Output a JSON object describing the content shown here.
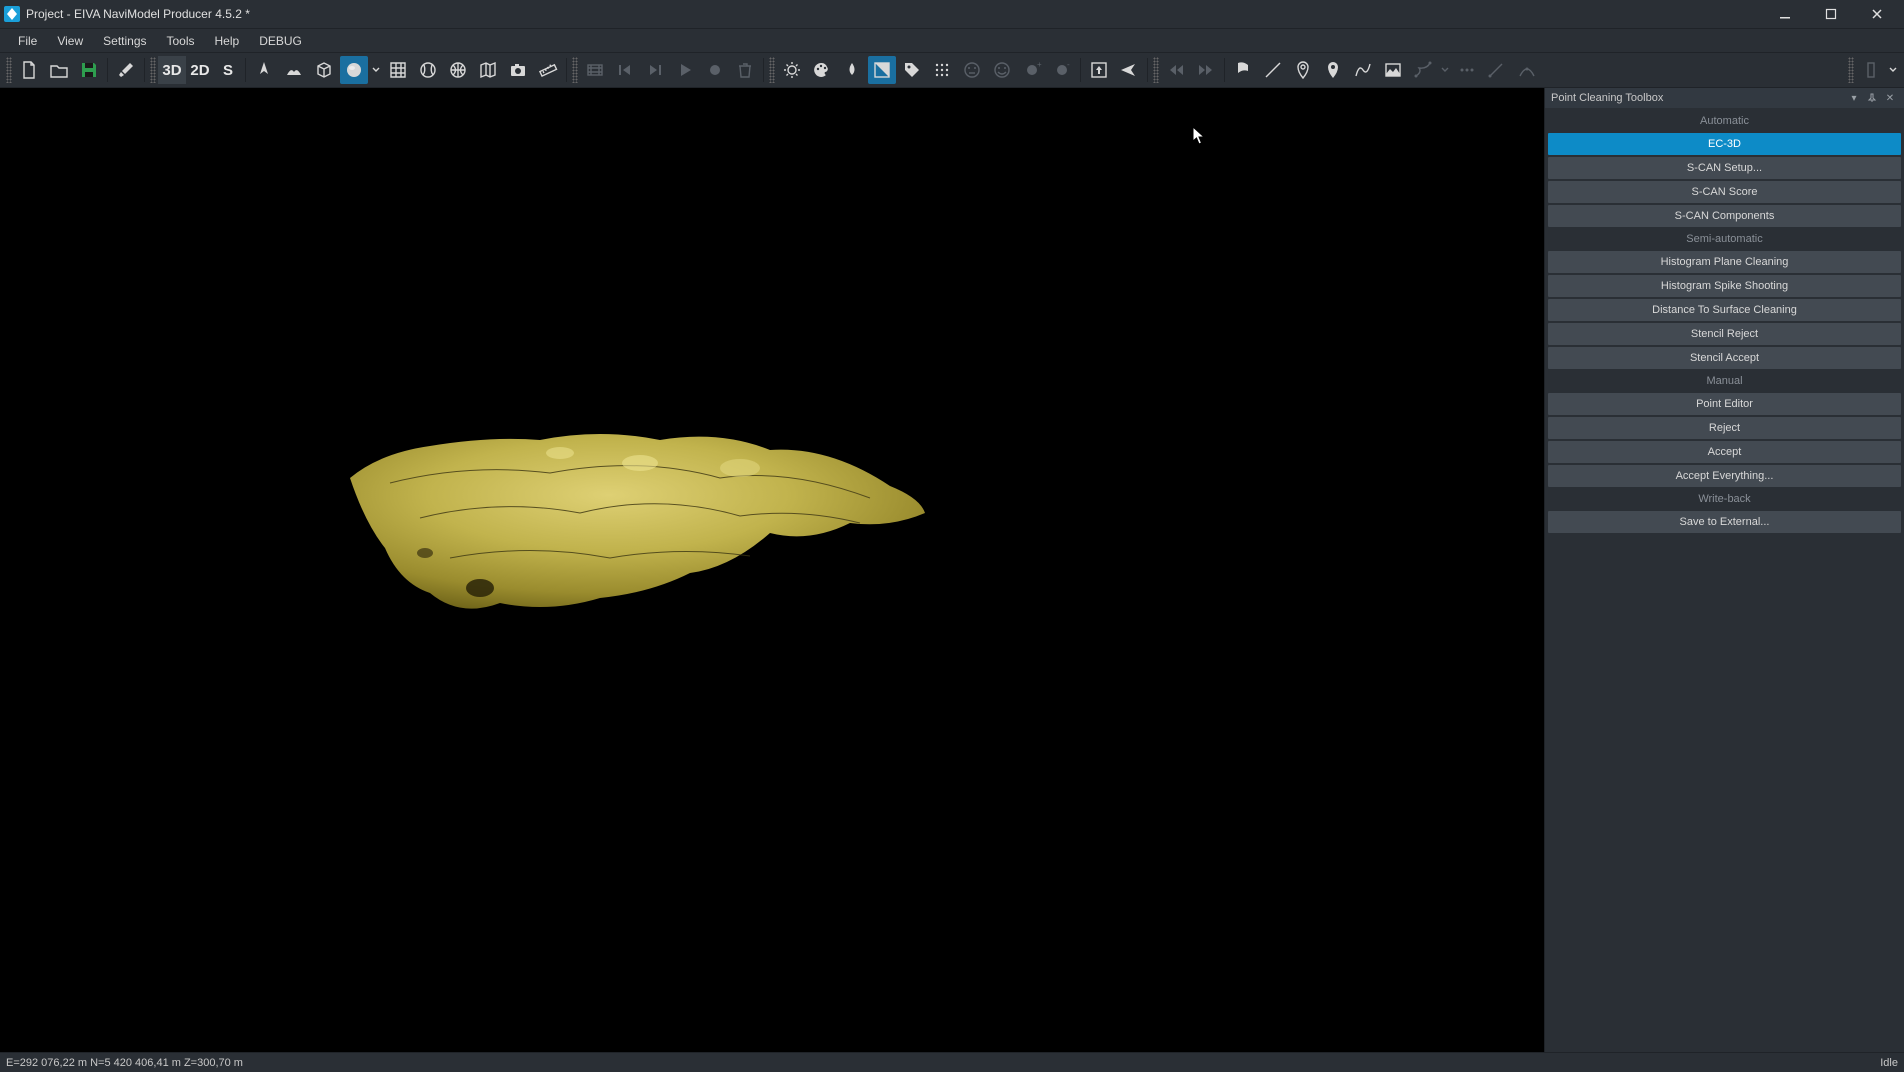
{
  "title": "Project - EIVA NaviModel Producer 4.5.2 *",
  "menu": {
    "file": "File",
    "view": "View",
    "settings": "Settings",
    "tools": "Tools",
    "help": "Help",
    "debug": "DEBUG"
  },
  "toolbar": {
    "btn3d": "3D",
    "btn2d": "2D",
    "btnS": "S"
  },
  "panel": {
    "title": "Point Cleaning Toolbox",
    "sections": {
      "automatic": "Automatic",
      "semi": "Semi-automatic",
      "manual": "Manual",
      "writeback": "Write-back"
    },
    "buttons": {
      "ec3d": "EC-3D",
      "scan_setup": "S-CAN Setup...",
      "scan_score": "S-CAN Score",
      "scan_components": "S-CAN Components",
      "hist_plane": "Histogram Plane Cleaning",
      "hist_spike": "Histogram Spike Shooting",
      "dist_surface": "Distance To Surface Cleaning",
      "stencil_reject": "Stencil Reject",
      "stencil_accept": "Stencil Accept",
      "point_editor": "Point Editor",
      "reject": "Reject",
      "accept": "Accept",
      "accept_everything": "Accept Everything...",
      "save_external": "Save to External..."
    }
  },
  "status": {
    "coords": "E=292 076,22 m N=5 420 406,41 m Z=300,70 m",
    "idle": "Idle"
  }
}
